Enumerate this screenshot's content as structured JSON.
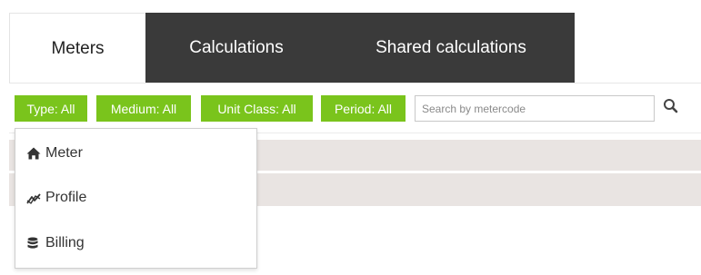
{
  "tabs": [
    {
      "label": "Meters"
    },
    {
      "label": "Calculations"
    },
    {
      "label": "Shared calculations"
    }
  ],
  "filters": {
    "type": "Type: All",
    "medium": "Medium: All",
    "unit_class": "Unit Class: All",
    "period": "Period: All"
  },
  "search": {
    "placeholder": "Search by metercode",
    "value": ""
  },
  "dropdown": {
    "items": [
      {
        "label": "Meter",
        "icon": "home-icon"
      },
      {
        "label": "Profile",
        "icon": "trend-chart-icon"
      },
      {
        "label": "Billing",
        "icon": "database-icon"
      }
    ]
  },
  "colors": {
    "filter_green": "#7ac41c",
    "dark_tab": "#3a3a3a",
    "row_bg": "#e9e4e2"
  }
}
